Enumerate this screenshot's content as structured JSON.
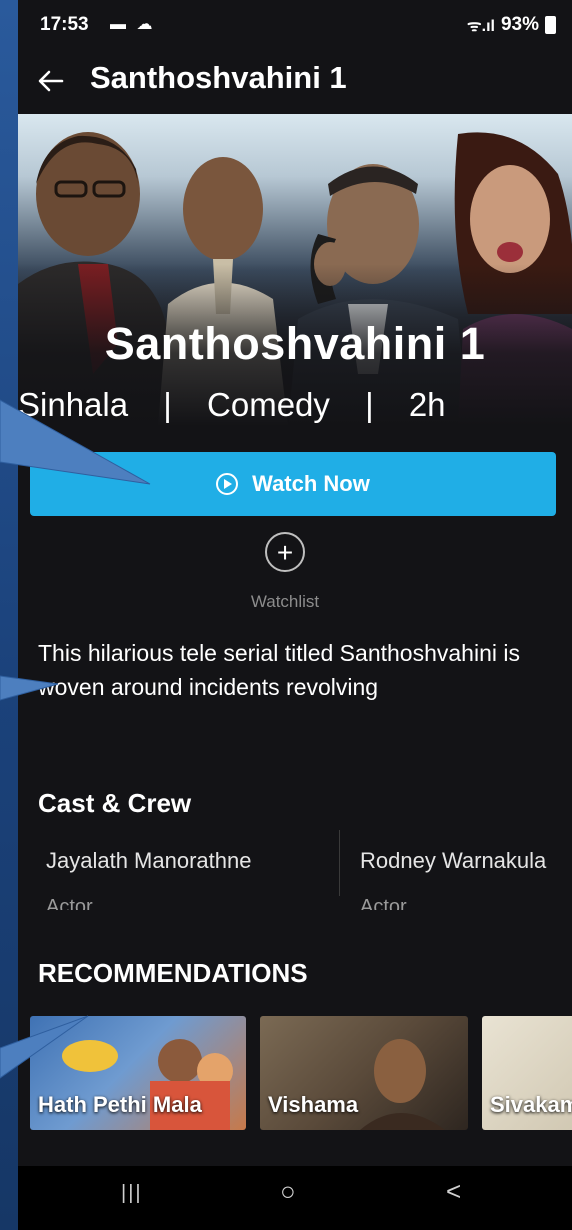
{
  "status_bar": {
    "time": "17:53",
    "notif_icons": "▬ ☁",
    "signal_text": "ᯤ.ıl",
    "battery": "93%"
  },
  "app_bar": {
    "title": "Santhoshvahini 1"
  },
  "hero": {
    "title": "Santhoshvahini 1"
  },
  "meta": {
    "language": "Sinhala",
    "genre": "Comedy",
    "duration": "2h",
    "separator": "|"
  },
  "actions": {
    "watch_label": "Watch Now",
    "watchlist_label": "Watchlist",
    "watchlist_glyph": "+"
  },
  "description": "This hilarious tele serial titled Santhoshvahini is woven around incidents revolving",
  "cast_section": {
    "title": "Cast & Crew",
    "members": [
      {
        "name": "Jayalath Manorathne",
        "role": "Actor"
      },
      {
        "name": "Rodney Warnakula",
        "role": "Actor"
      }
    ]
  },
  "recommendations": {
    "title": "RECOMMENDATIONS",
    "items": [
      {
        "title": "Hath Pethi Mala",
        "color": "#4c7bb8"
      },
      {
        "title": "Vishama",
        "color": "#6b5a44"
      },
      {
        "title": "Sivakami",
        "color": "#d9d2c0"
      }
    ]
  },
  "nav": {
    "recents_glyph": "|||",
    "home_glyph": "○",
    "back_glyph": "<"
  },
  "colors": {
    "accent": "#20aee6",
    "background": "#131316",
    "callout": "#4d7fbf"
  }
}
